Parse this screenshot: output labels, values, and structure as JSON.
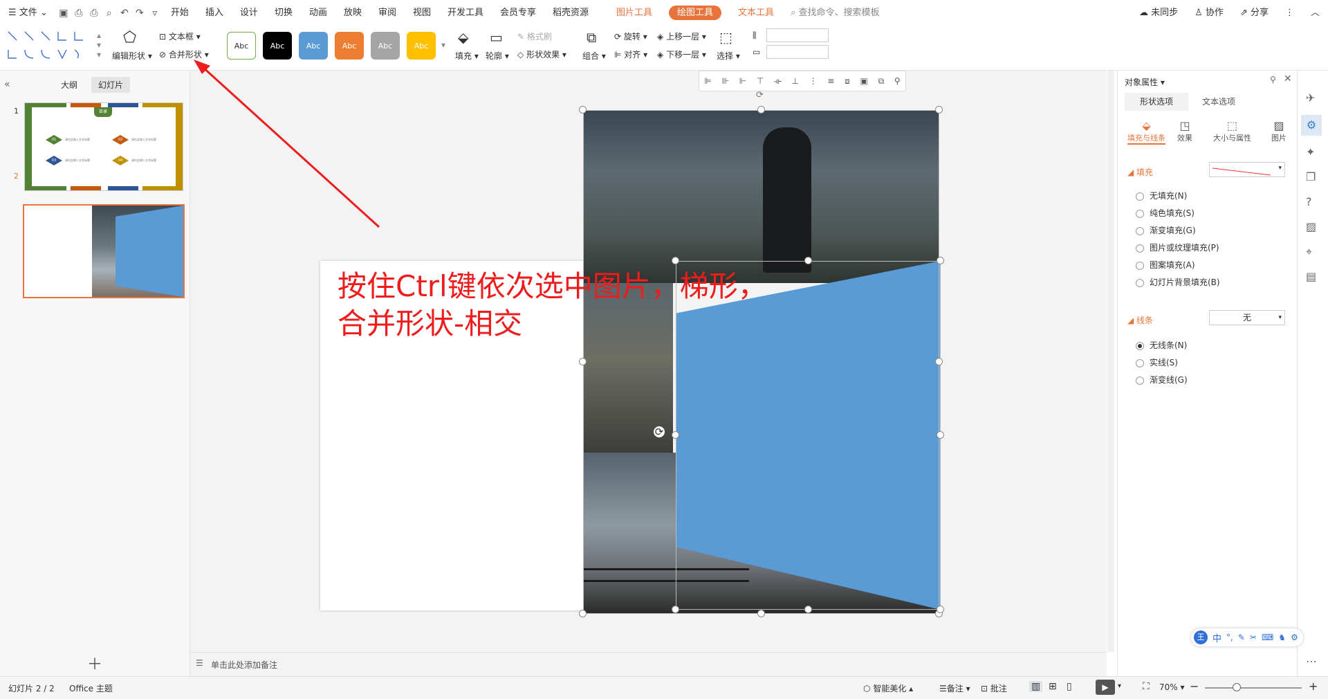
{
  "menubar": {
    "file_label": "文件",
    "tabs": [
      "开始",
      "插入",
      "设计",
      "切换",
      "动画",
      "放映",
      "审阅",
      "视图",
      "开发工具",
      "会员专享",
      "稻壳资源"
    ],
    "context_tabs": [
      "图片工具",
      "绘图工具",
      "文本工具"
    ],
    "search_placeholder": "查找命令、搜索模板",
    "sync": "未同步",
    "collab": "协作",
    "share": "分享"
  },
  "ribbon": {
    "edit_shape": "编辑形状",
    "textbox": "文本框",
    "merge_shape": "合并形状",
    "style_label": "Abc",
    "fill": "填充",
    "outline": "轮廓",
    "format_painter": "格式刷",
    "shape_effect": "形状效果",
    "group": "组合",
    "rotate": "旋转",
    "align": "对齐",
    "bring_forward": "上移一层",
    "send_backward": "下移一层",
    "select": "选择"
  },
  "leftpane": {
    "tab_outline": "大纲",
    "tab_slides": "幻灯片",
    "slide1_num": "1",
    "slide2_num": "2",
    "slide1_title": "目录",
    "slide1_items": [
      "01",
      "02",
      "03",
      "04"
    ],
    "slide1_text": "请在此输入文本标题"
  },
  "canvas": {
    "annotation_line1": "按住Ctrl键依次选中图片，梯形，",
    "annotation_line2": "合并形状-相交"
  },
  "notes": {
    "placeholder": "单击此处添加备注"
  },
  "rpanel": {
    "title": "对象属性",
    "tab_shape": "形状选项",
    "tab_text": "文本选项",
    "subtabs": [
      "填充与线条",
      "效果",
      "大小与属性",
      "图片"
    ],
    "fill_header": "填充",
    "fill_options": [
      "无填充(N)",
      "纯色填充(S)",
      "渐变填充(G)",
      "图片或纹理填充(P)",
      "图案填充(A)",
      "幻灯片背景填充(B)"
    ],
    "line_header": "线条",
    "line_value": "无",
    "line_options": [
      "无线条(N)",
      "实线(S)",
      "渐变线(G)"
    ]
  },
  "ime": {
    "label": "中"
  },
  "status": {
    "slide_info": "幻灯片 2 / 2",
    "theme": "Office 主题",
    "beautify": "智能美化",
    "notes": "备注",
    "comment": "批注",
    "zoom": "70%"
  },
  "colors": {
    "accent": "#e8743b",
    "shape_blue": "#5b9bd5",
    "arrow_red": "#ee1c1c"
  }
}
